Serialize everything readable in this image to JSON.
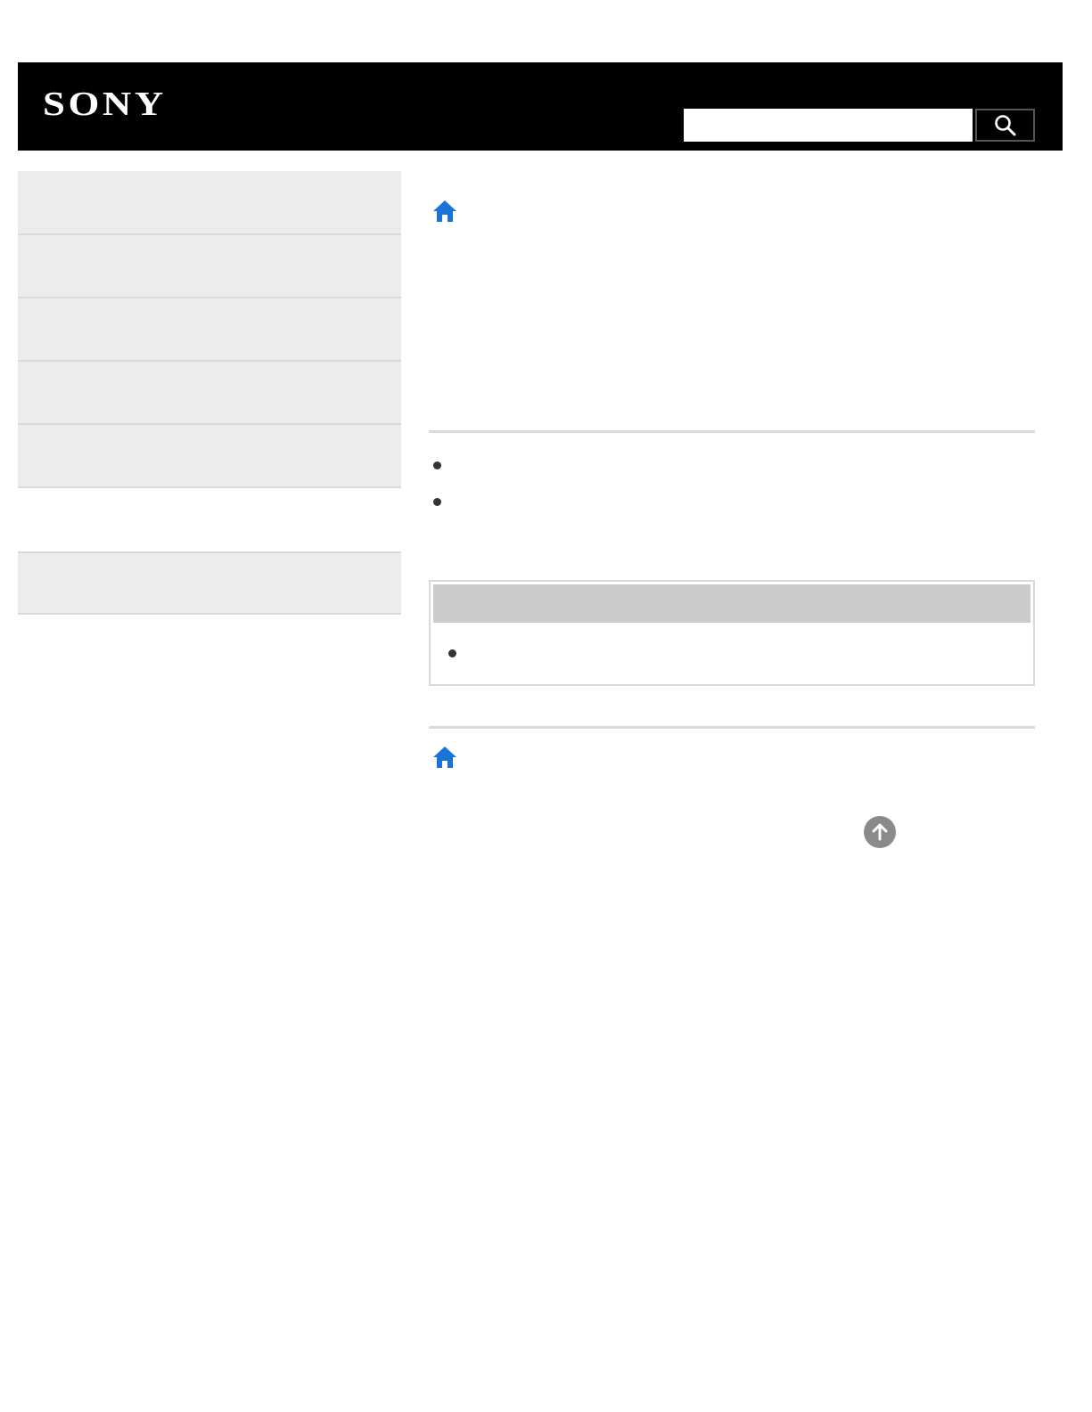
{
  "header": {
    "logo": "SONY",
    "search": {
      "value": "",
      "placeholder": "",
      "button_icon": "search-icon"
    }
  },
  "sidebar": {
    "items": [
      {
        "label": ""
      },
      {
        "label": ""
      },
      {
        "label": ""
      },
      {
        "label": ""
      },
      {
        "label": ""
      },
      {
        "label": ""
      }
    ]
  },
  "main": {
    "home_icon": "home-icon",
    "bullets": [
      "",
      ""
    ],
    "note": {
      "title": "",
      "items": [
        ""
      ]
    },
    "back_to_top_icon": "arrow-up-circle-icon"
  },
  "colors": {
    "header_bg": "#000000",
    "nav_bg": "#ececec",
    "divider": "#d9d9d9",
    "note_header_bg": "#cccccc",
    "home_icon": "#1a73d9",
    "back_to_top": "#8a8a8a"
  }
}
